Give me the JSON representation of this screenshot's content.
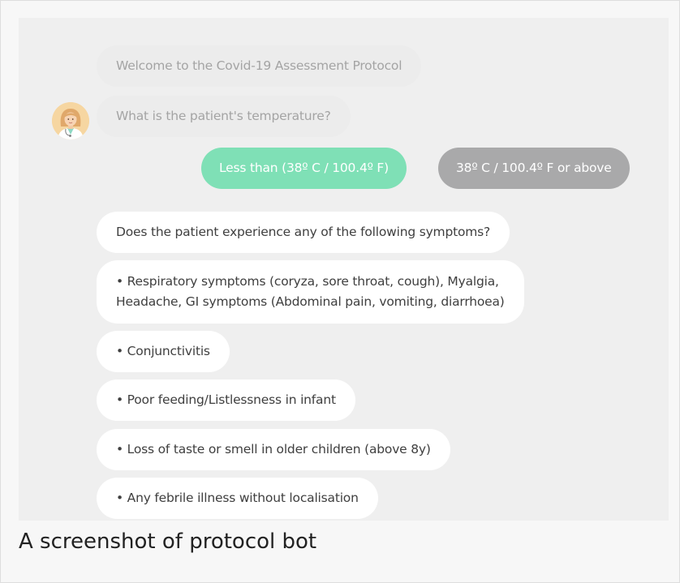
{
  "chat": {
    "welcome": "Welcome to the Covid-19 Assessment Protocol",
    "question_temperature": "What is the patient's temperature?",
    "options": [
      "Less than (38º C / 100.4º F)",
      "38º C / 100.4º F or above"
    ],
    "question_symptoms": "Does the patient experience any of the following symptoms?",
    "symptoms": [
      {
        "line1": "• Respiratory symptoms (coryza, sore throat, cough), Myalgia,",
        "line2": "Headache, GI symptoms (Abdominal pain, vomiting, diarrhoea)"
      },
      "• Conjunctivitis",
      "• Poor feeding/Listlessness in infant",
      "• Loss of taste or smell in older children (above 8y)",
      "• Any febrile illness without localisation"
    ]
  },
  "avatar_icon": "doctor-avatar-icon",
  "colors": {
    "option_selected": "#7fe0b6",
    "option_unselected": "#a9a9aa",
    "chat_background": "#efefef"
  },
  "caption": "A screenshot of protocol bot"
}
